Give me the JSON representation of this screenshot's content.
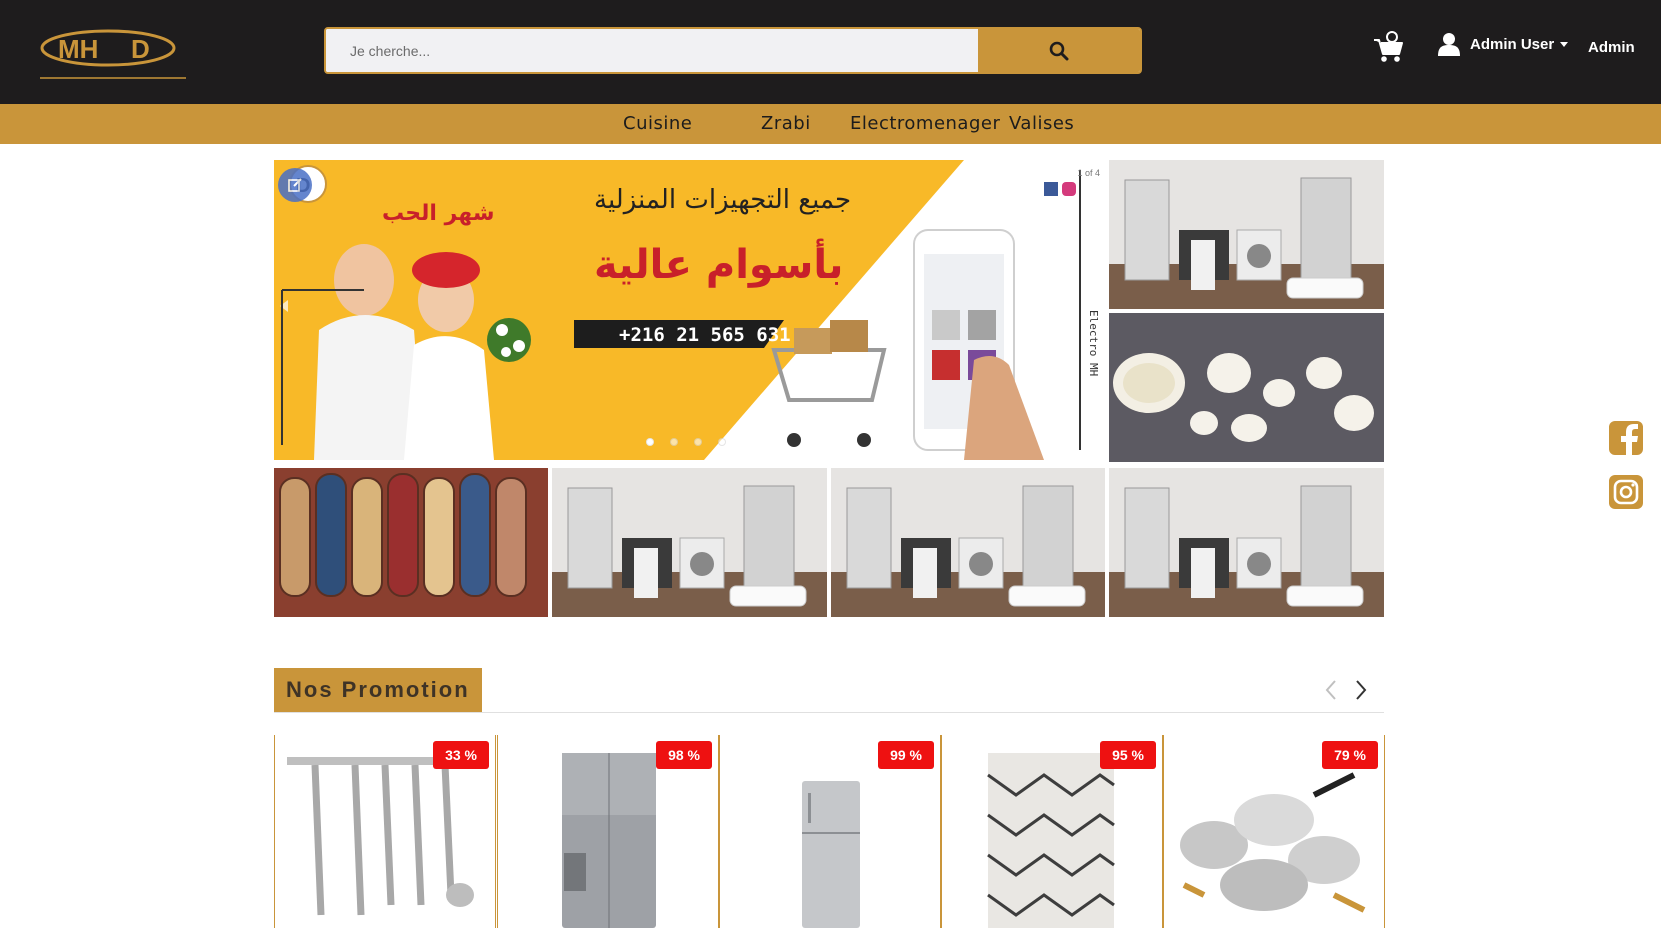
{
  "header": {
    "logo_text": "MH",
    "search_placeholder": "Je cherche...",
    "user_name": "Admin User",
    "admin_label": "Admin"
  },
  "categories": [
    "Cuisine",
    "Zrabi",
    "Electromenager",
    "Valises"
  ],
  "banner": {
    "arabic_title": "جميع التجهيزات المنزلية",
    "arabic_subtitle": "بأسوام عالية",
    "arabic_tag": "شهر الحب",
    "phone": "+216 21 565 631",
    "side_text": "Electro MH",
    "counter": "1 of 4",
    "slides": 4,
    "active_slide": 1
  },
  "promotions": {
    "title": "Nos Promotion",
    "items": [
      {
        "discount": "33 %",
        "image": "kitchen-utensils"
      },
      {
        "discount": "98 %",
        "image": "refrigerator-large"
      },
      {
        "discount": "99 %",
        "image": "refrigerator-slim"
      },
      {
        "discount": "95 %",
        "image": "rug"
      },
      {
        "discount": "79 %",
        "image": "cookware-set"
      }
    ]
  },
  "colors": {
    "header_bg": "#1e1c1d",
    "accent": "#c9953a",
    "badge": "#ee1111",
    "facebook": "#c9953a",
    "instagram": "#c9953a"
  }
}
